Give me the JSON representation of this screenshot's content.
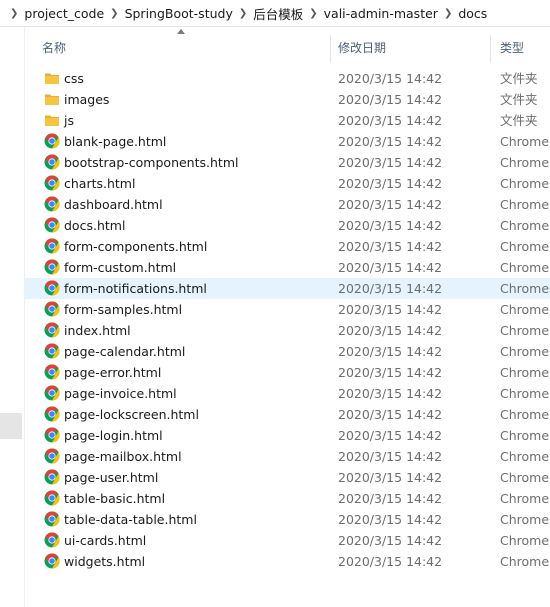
{
  "breadcrumb": [
    "project_code",
    "SpringBoot-study",
    "后台模板",
    "vali-admin-master",
    "docs"
  ],
  "columns": {
    "name": "名称",
    "modified": "修改日期",
    "type": "类型"
  },
  "files": [
    {
      "name": "css",
      "modified": "2020/3/15 14:42",
      "type": "文件夹",
      "icon": "folder-icon"
    },
    {
      "name": "images",
      "modified": "2020/3/15 14:42",
      "type": "文件夹",
      "icon": "folder-icon"
    },
    {
      "name": "js",
      "modified": "2020/3/15 14:42",
      "type": "文件夹",
      "icon": "folder-icon"
    },
    {
      "name": "blank-page.html",
      "modified": "2020/3/15 14:42",
      "type": "Chrome",
      "icon": "chrome-icon"
    },
    {
      "name": "bootstrap-components.html",
      "modified": "2020/3/15 14:42",
      "type": "Chrome",
      "icon": "chrome-icon"
    },
    {
      "name": "charts.html",
      "modified": "2020/3/15 14:42",
      "type": "Chrome",
      "icon": "chrome-icon"
    },
    {
      "name": "dashboard.html",
      "modified": "2020/3/15 14:42",
      "type": "Chrome",
      "icon": "chrome-icon"
    },
    {
      "name": "docs.html",
      "modified": "2020/3/15 14:42",
      "type": "Chrome",
      "icon": "chrome-icon"
    },
    {
      "name": "form-components.html",
      "modified": "2020/3/15 14:42",
      "type": "Chrome",
      "icon": "chrome-icon"
    },
    {
      "name": "form-custom.html",
      "modified": "2020/3/15 14:42",
      "type": "Chrome",
      "icon": "chrome-icon"
    },
    {
      "name": "form-notifications.html",
      "modified": "2020/3/15 14:42",
      "type": "Chrome",
      "icon": "chrome-icon",
      "selected": true
    },
    {
      "name": "form-samples.html",
      "modified": "2020/3/15 14:42",
      "type": "Chrome",
      "icon": "chrome-icon"
    },
    {
      "name": "index.html",
      "modified": "2020/3/15 14:42",
      "type": "Chrome",
      "icon": "chrome-icon"
    },
    {
      "name": "page-calendar.html",
      "modified": "2020/3/15 14:42",
      "type": "Chrome",
      "icon": "chrome-icon"
    },
    {
      "name": "page-error.html",
      "modified": "2020/3/15 14:42",
      "type": "Chrome",
      "icon": "chrome-icon"
    },
    {
      "name": "page-invoice.html",
      "modified": "2020/3/15 14:42",
      "type": "Chrome",
      "icon": "chrome-icon"
    },
    {
      "name": "page-lockscreen.html",
      "modified": "2020/3/15 14:42",
      "type": "Chrome",
      "icon": "chrome-icon"
    },
    {
      "name": "page-login.html",
      "modified": "2020/3/15 14:42",
      "type": "Chrome",
      "icon": "chrome-icon"
    },
    {
      "name": "page-mailbox.html",
      "modified": "2020/3/15 14:42",
      "type": "Chrome",
      "icon": "chrome-icon"
    },
    {
      "name": "page-user.html",
      "modified": "2020/3/15 14:42",
      "type": "Chrome",
      "icon": "chrome-icon"
    },
    {
      "name": "table-basic.html",
      "modified": "2020/3/15 14:42",
      "type": "Chrome",
      "icon": "chrome-icon"
    },
    {
      "name": "table-data-table.html",
      "modified": "2020/3/15 14:42",
      "type": "Chrome",
      "icon": "chrome-icon"
    },
    {
      "name": "ui-cards.html",
      "modified": "2020/3/15 14:42",
      "type": "Chrome",
      "icon": "chrome-icon"
    },
    {
      "name": "widgets.html",
      "modified": "2020/3/15 14:42",
      "type": "Chrome",
      "icon": "chrome-icon"
    }
  ],
  "colors": {
    "selected_row": "#e5f3ff",
    "header_text": "#4c607a",
    "folder": "#f5c443",
    "chrome_red": "#db4437",
    "chrome_yellow": "#f4c20d",
    "chrome_green": "#0f9d58",
    "chrome_blue": "#4285f4"
  }
}
